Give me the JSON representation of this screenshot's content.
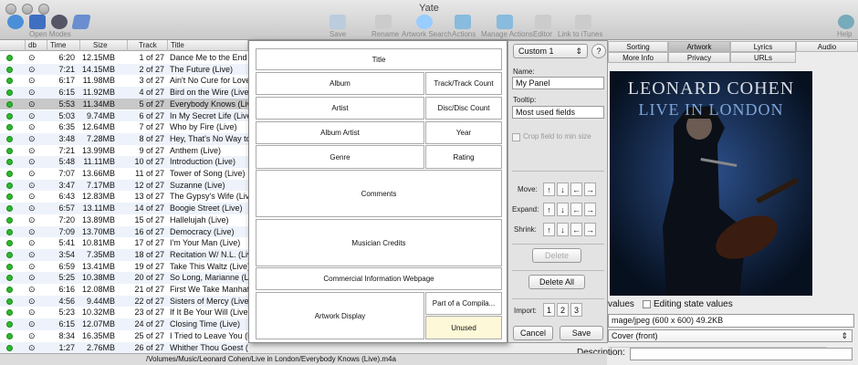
{
  "window": {
    "title": "Yate"
  },
  "toolbar": {
    "open_modes": "Open Modes",
    "save": "Save",
    "rename": "Rename",
    "artwork_search": "Artwork Search",
    "actions": "Actions",
    "manage_actions": "Manage Actions",
    "editor": "Editor",
    "link_itunes": "Link to iTunes",
    "help": "Help"
  },
  "table": {
    "headers": {
      "db": "db",
      "time": "Time",
      "size": "Size",
      "track": "Track",
      "title": "Title"
    },
    "rows": [
      {
        "time": "6:20",
        "size": "12.15MB",
        "track": "1 of 27",
        "title": "Dance Me to the End"
      },
      {
        "time": "7:21",
        "size": "14.15MB",
        "track": "2 of 27",
        "title": "The Future (Live)"
      },
      {
        "time": "6:17",
        "size": "11.98MB",
        "track": "3 of 27",
        "title": "Ain't No Cure for Love"
      },
      {
        "time": "6:15",
        "size": "11.92MB",
        "track": "4 of 27",
        "title": "Bird on the Wire (Live)"
      },
      {
        "time": "5:53",
        "size": "11.34MB",
        "track": "5 of 27",
        "title": "Everybody Knows (Live)"
      },
      {
        "time": "5:03",
        "size": "9.74MB",
        "track": "6 of 27",
        "title": "In My Secret Life (Live)"
      },
      {
        "time": "6:35",
        "size": "12.64MB",
        "track": "7 of 27",
        "title": "Who by Fire (Live)"
      },
      {
        "time": "3:48",
        "size": "7.28MB",
        "track": "8 of 27",
        "title": "Hey, That's No Way to"
      },
      {
        "time": "7:21",
        "size": "13.99MB",
        "track": "9 of 27",
        "title": "Anthem (Live)"
      },
      {
        "time": "5:48",
        "size": "11.11MB",
        "track": "10 of 27",
        "title": "Introduction (Live)"
      },
      {
        "time": "7:07",
        "size": "13.66MB",
        "track": "11 of 27",
        "title": "Tower of Song (Live)"
      },
      {
        "time": "3:47",
        "size": "7.17MB",
        "track": "12 of 27",
        "title": "Suzanne (Live)"
      },
      {
        "time": "6:43",
        "size": "12.83MB",
        "track": "13 of 27",
        "title": "The Gypsy's Wife (Live)"
      },
      {
        "time": "6:57",
        "size": "13.11MB",
        "track": "14 of 27",
        "title": "Boogie Street (Live)"
      },
      {
        "time": "7:20",
        "size": "13.89MB",
        "track": "15 of 27",
        "title": "Hallelujah (Live)"
      },
      {
        "time": "7:09",
        "size": "13.70MB",
        "track": "16 of 27",
        "title": "Democracy (Live)"
      },
      {
        "time": "5:41",
        "size": "10.81MB",
        "track": "17 of 27",
        "title": "I'm Your Man (Live)"
      },
      {
        "time": "3:54",
        "size": "7.35MB",
        "track": "18 of 27",
        "title": "Recitation W/ N.L. (Live)"
      },
      {
        "time": "6:59",
        "size": "13.41MB",
        "track": "19 of 27",
        "title": "Take This Waltz (Live)"
      },
      {
        "time": "5:25",
        "size": "10.38MB",
        "track": "20 of 27",
        "title": "So Long, Marianne (Live)"
      },
      {
        "time": "6:16",
        "size": "12.08MB",
        "track": "21 of 27",
        "title": "First We Take Manhattan"
      },
      {
        "time": "4:56",
        "size": "9.44MB",
        "track": "22 of 27",
        "title": "Sisters of Mercy (Live)"
      },
      {
        "time": "5:23",
        "size": "10.32MB",
        "track": "23 of 27",
        "title": "If It Be Your Will (Live)"
      },
      {
        "time": "6:15",
        "size": "12.07MB",
        "track": "24 of 27",
        "title": "Closing Time (Live)"
      },
      {
        "time": "8:34",
        "size": "16.35MB",
        "track": "25 of 27",
        "title": "I Tried to Leave You (Live)"
      },
      {
        "time": "1:27",
        "size": "2.76MB",
        "track": "26 of 27",
        "title": "Whither Thou Goest (Live)",
        "artist": "Leonard Cohen",
        "album": "Live in London"
      }
    ]
  },
  "panel": {
    "title": "Title",
    "album": "Album",
    "track_count": "Track/Track Count",
    "artist": "Artist",
    "disc_count": "Disc/Disc Count",
    "album_artist": "Album Artist",
    "year": "Year",
    "genre": "Genre",
    "rating": "Rating",
    "comments": "Comments",
    "musician_credits": "Musician Credits",
    "commercial": "Commercial Information Webpage",
    "artwork_display": "Artwork Display",
    "compilation": "Part of a Compila...",
    "unused": "Unused"
  },
  "side": {
    "preset": "Custom 1",
    "help": "?",
    "name_label": "Name:",
    "name_value": "My Panel",
    "tooltip_label": "Tooltip:",
    "tooltip_value": "Most used fields",
    "crop_label": "Crop field to min size",
    "move_label": "Move:",
    "expand_label": "Expand:",
    "shrink_label": "Shrink:",
    "arrows": [
      "↑",
      "↓",
      "←",
      "→"
    ],
    "delete": "Delete",
    "delete_all": "Delete All",
    "import_label": "Import:",
    "import_opts": [
      "1",
      "2",
      "3"
    ],
    "cancel": "Cancel",
    "save": "Save"
  },
  "tabs": {
    "sorting": "Sorting",
    "artwork": "Artwork",
    "lyrics": "Lyrics",
    "audio": "Audio",
    "more_info": "More Info",
    "privacy": "Privacy",
    "urls": "URLs"
  },
  "artwork": {
    "artist_text": "LEONARD COHEN",
    "album_text": "LIVE IN LONDON",
    "values_label": "values",
    "editing_label": "Editing state values",
    "format": "mage/jpeg (600 x 600) 49.2KB",
    "type": "Cover (front)",
    "description_label": "Description:",
    "description_value": ""
  },
  "status": {
    "path": "/Volumes/Music/Leonard Cohen/Live in London/Everybody Knows (Live).m4a"
  },
  "colors": {
    "selected_row": "#c8c8c8",
    "unused_bg": "#fdf8d8",
    "status_dot": "#2db82d"
  }
}
